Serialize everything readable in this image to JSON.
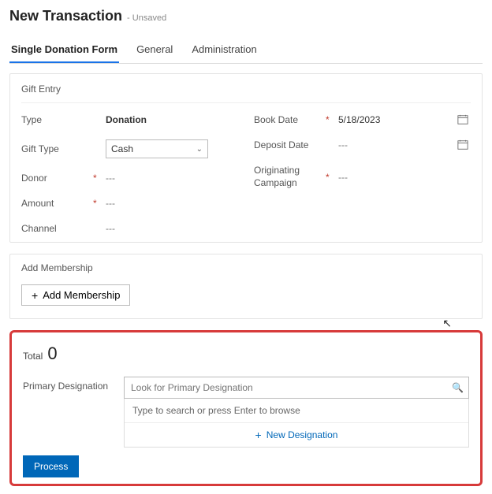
{
  "header": {
    "title": "New Transaction",
    "status": "- Unsaved"
  },
  "tabs": {
    "items": [
      {
        "label": "Single Donation Form",
        "active": true
      },
      {
        "label": "General",
        "active": false
      },
      {
        "label": "Administration",
        "active": false
      }
    ]
  },
  "giftEntry": {
    "title": "Gift Entry",
    "left": {
      "type": {
        "label": "Type",
        "value": "Donation"
      },
      "giftType": {
        "label": "Gift Type",
        "value": "Cash"
      },
      "donor": {
        "label": "Donor",
        "value": "---",
        "required": true
      },
      "amount": {
        "label": "Amount",
        "value": "---",
        "required": true
      },
      "channel": {
        "label": "Channel",
        "value": "---"
      }
    },
    "right": {
      "bookDate": {
        "label": "Book Date",
        "value": "5/18/2023",
        "required": true
      },
      "depositDate": {
        "label": "Deposit Date",
        "value": "---"
      },
      "origCampaign": {
        "label": "Originating Campaign",
        "value": "---",
        "required": true
      }
    }
  },
  "membership": {
    "title": "Add Membership",
    "buttonLabel": "Add Membership"
  },
  "totals": {
    "label": "Total",
    "value": "0"
  },
  "primaryDesignation": {
    "label": "Primary Designation",
    "placeholder": "Look for Primary Designation",
    "hint": "Type to search or press Enter to browse",
    "newLabel": "New Designation"
  },
  "process": {
    "label": "Process"
  }
}
